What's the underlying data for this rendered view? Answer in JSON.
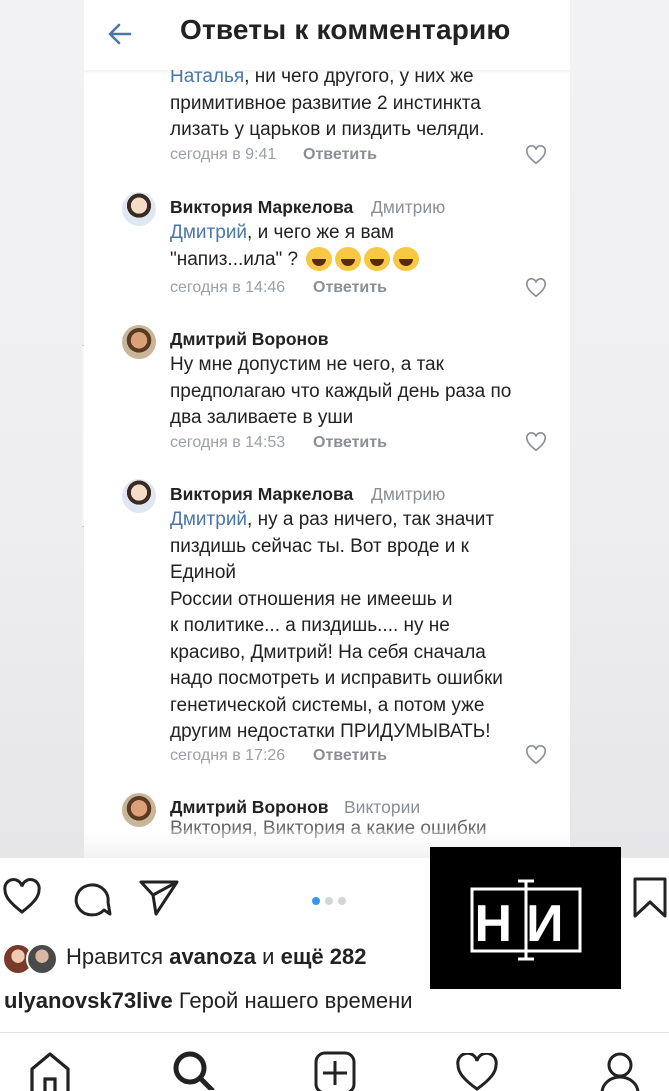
{
  "vk": {
    "title": "Ответы к комментарию",
    "comments": [
      {
        "text_mention": "Наталья",
        "text_rest": ", ни чего другого, у них же\nпримитивное развитие 2 инстинкта\nлизать у царьков и пиздить челяди.",
        "time": "сегодня в 9:41",
        "reply_label": "Ответить"
      },
      {
        "author": "Виктория Маркелова",
        "reply_to": "Дмитрию",
        "text_mention": "Дмитрий",
        "text_rest": ", и чего же я вам\n\"напиз...ила\" ? ",
        "time": "сегодня в 14:46",
        "reply_label": "Ответить"
      },
      {
        "author": "Дмитрий Воронов",
        "reply_to": "",
        "text_rest": "Ну мне допустим не чего, а так\nпредполагаю что каждый день раза по\nдва заливаете в уши",
        "time": "сегодня в 14:53",
        "reply_label": "Ответить"
      },
      {
        "author": "Виктория Маркелова",
        "reply_to": "Дмитрию",
        "text_mention": "Дмитрий",
        "text_rest": ", ну а раз ничего, так значит\nпиздишь сейчас ты. Вот вроде и к\nЕдиной\nРоссии отношения не имеешь и\nк политике... а пиздишь.... ну не\nкрасиво, Дмитрий! На себя сначала\nнадо посмотреть и исправить ошибки\nгенетической системы, а потом уже\nдругим недостатки ПРИДУМЫВАТЬ!",
        "time": "сегодня в 17:26",
        "reply_label": "Ответить"
      },
      {
        "author": "Дмитрий Воронов",
        "reply_to": "Виктории",
        "text_rest": "Виктория, Виктория а какие ошибки"
      }
    ]
  },
  "instagram": {
    "likes_prefix": "Нравится",
    "likes_user": "avanoza",
    "likes_mid": "и",
    "likes_count": "ещё 282",
    "caption_user": "ulyanovsk73live",
    "caption_text": "Герой нашего времени",
    "logo_text": "НИ",
    "accent": "#3897f0"
  }
}
